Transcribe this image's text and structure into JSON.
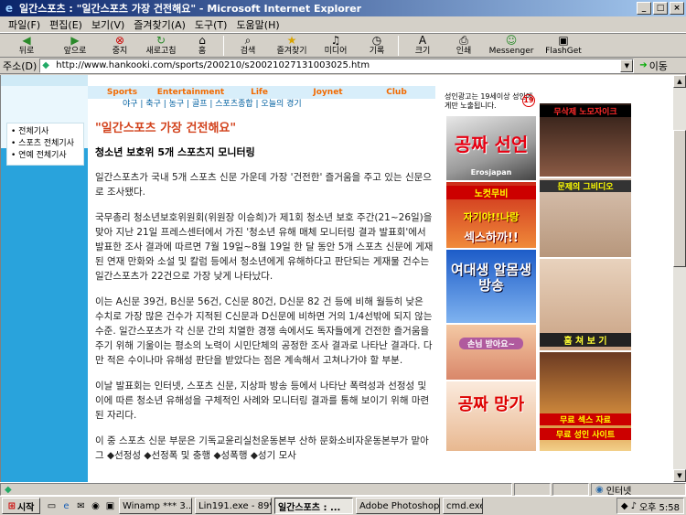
{
  "window": {
    "title": "일간스포츠 : \"일간스포츠 가장 건전해요\" - Microsoft Internet Explorer"
  },
  "menu": [
    "파일(F)",
    "편집(E)",
    "보기(V)",
    "즐겨찾기(A)",
    "도구(T)",
    "도움말(H)"
  ],
  "toolbar": {
    "back": "뒤로",
    "forward": "앞으로",
    "stop": "중지",
    "refresh": "새로고침",
    "home": "홈",
    "search": "검색",
    "favorites": "즐겨찾기",
    "media": "미디어",
    "history": "기록",
    "size": "크기",
    "print": "인쇄",
    "messenger": "Messenger",
    "flashget": "FlashGet"
  },
  "address": {
    "label": "주소(D)",
    "url": "http://www.hankooki.com/sports/200210/s20021027131003025.htm",
    "go": "이동"
  },
  "site_nav": {
    "tabs": [
      "Sports",
      "Entertainment",
      "Life",
      "Joynet",
      "Club"
    ],
    "sub": "야구 | 축구 | 농구 | 골프 | 스포츠종합 | 오늘의 경기"
  },
  "side_menu": [
    "• 전체기사",
    "• 스포츠 전체기사",
    "• 연예 전체기사"
  ],
  "article": {
    "headline": "\"일간스포츠 가장 건전해요\"",
    "subhead": "청소년 보호위 5개 스포츠지 모니터링",
    "p1": "일간스포츠가 국내 5개 스포츠 신문 가운데 가장 '건전한' 즐거움을 주고 있는 신문으로 조사됐다.",
    "p2": "국무총리 청소년보호위원회(위원장 이승희)가 제1회 청소년 보호 주간(21~26일)을 맞아 지난 21일 프레스센터에서 가진 '청소년 유해 매체 모니터링 결과 발표회'에서 발표한 조사 결과에 따르면 7월 19일~8월 19일 한 달 동안 5개 스포츠 신문에 게재된 연재 만화와 소설 및 칼럼 등에서 청소년에게 유해하다고 판단되는 게재물 건수는 일간스포츠가 22건으로 가장 낮게 나타났다.",
    "p3": "이는 A신문 39건, B신문 56건, C신문 80건, D신문 82 건 등에 비해 월등히 낮은 수치로 가장 많은 건수가 지적된 C신문과 D신문에 비하면 거의 1/4선밖에 되지 않는 수준. 일간스포츠가 각 신문 간의 치열한 경쟁 속에서도 독자들에게 건전한 즐거움을 주기 위해 기울이는 평소의 노력이 시민단체의 공정한 조사 결과로 나타난 결과다. 다만 적은 수이나마 유해성 판단을 받았다는 점은 계속해서 고쳐나가야 할 부분.",
    "p4": "이날 발표회는 인터넷, 스포츠 신문, 지상파 방송 등에서 나타난 폭력성과 선정성 및 이에 따른 청소년 유해성을 구체적인 사례와 모니터링 결과를 통해 보이기 위해 마련된 자리다.",
    "p5": "이 중 스포츠 신문 부문은 기독교윤리실천운동본부 산하 문화소비자운동본부가 맡아 그 ◆선정성 ◆선정폭 및 충행 ◆성폭행 ◆성기 모사"
  },
  "ads": {
    "header": "성인광고는 19세이상 성인에게만 노출됩니다.",
    "badge": "19",
    "left": [
      {
        "big": "공짜 선언",
        "small": "Erosjapan"
      },
      {
        "t1": "노컷무비",
        "t2": "자기야!!나랑",
        "t3": "섹스하까!!"
      },
      {
        "t1": "여대생 알몸생방송"
      },
      {
        "t1": "손님 받아요~"
      },
      {
        "t1": "공짜 망가"
      }
    ],
    "right": [
      {
        "t1": "무삭제 노모자이크"
      },
      {
        "t1": "문제의 그비디오"
      },
      {
        "t1": "훔 쳐 보 기"
      },
      {
        "t1": "무료 섹스 자료",
        "t2": "무료 성인 사이트"
      }
    ]
  },
  "status": {
    "zone": "인터넷"
  },
  "taskbar": {
    "start": "시작",
    "tasks": [
      "Winamp *** 3...",
      "Lin191.exe - 89% ...",
      "일간스포츠 : ...",
      "Adobe Photoshop",
      "cmd.exe"
    ],
    "clock": "오후 5:58"
  }
}
